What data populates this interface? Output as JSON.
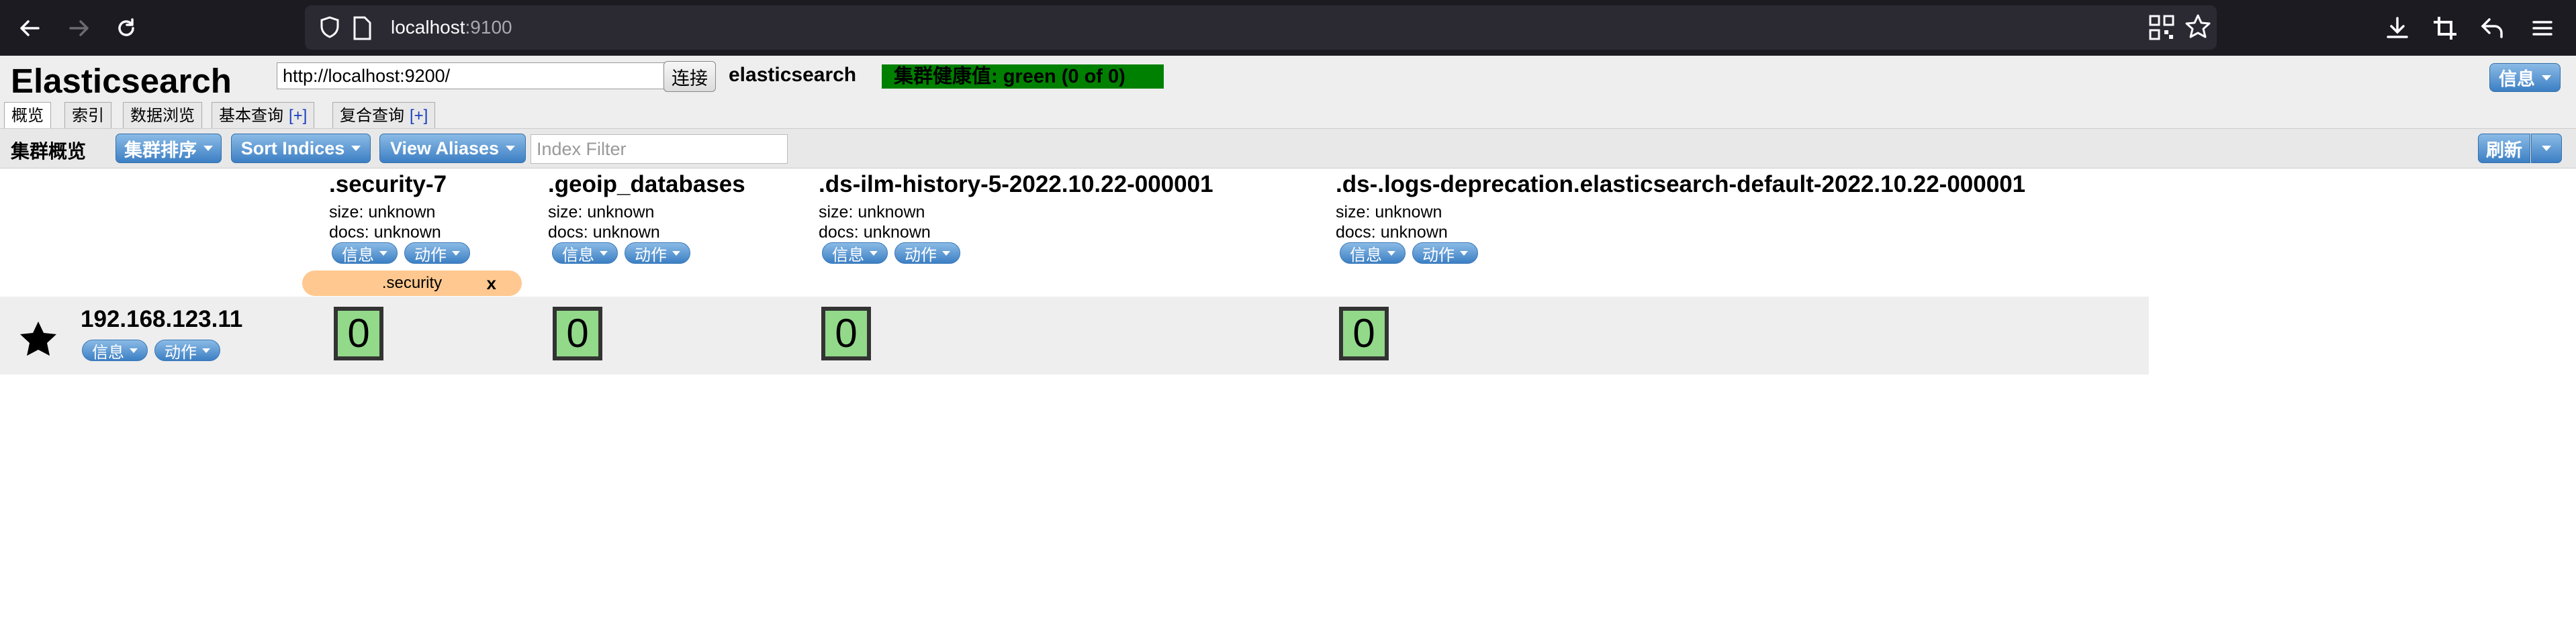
{
  "browser": {
    "url_host": "localhost",
    "url_port": ":9100"
  },
  "header": {
    "logo": "Elasticsearch",
    "cluster_url": "http://localhost:9200/",
    "connect_label": "连接",
    "cluster_name": "elasticsearch",
    "health": "集群健康值: green (0 of 0)",
    "info_label": "信息"
  },
  "tabs": [
    {
      "label": "概览",
      "plus": ""
    },
    {
      "label": "索引",
      "plus": ""
    },
    {
      "label": "数据浏览",
      "plus": ""
    },
    {
      "label": "基本查询",
      "plus": "[+]"
    },
    {
      "label": "复合查询",
      "plus": "[+]"
    }
  ],
  "toolbar": {
    "title": "集群概览",
    "sort_cluster_label": "集群排序",
    "sort_indices_label": "Sort Indices",
    "view_aliases_label": "View Aliases",
    "index_filter_placeholder": "Index Filter",
    "refresh_label": "刷新"
  },
  "indices": [
    {
      "name": ".security-7",
      "size": "size: unknown",
      "docs": "docs: unknown",
      "info": "信息",
      "action": "动作"
    },
    {
      "name": ".geoip_databases",
      "size": "size: unknown",
      "docs": "docs: unknown",
      "info": "信息",
      "action": "动作"
    },
    {
      "name": ".ds-ilm-history-5-2022.10.22-000001",
      "size": "size: unknown",
      "docs": "docs: unknown",
      "info": "信息",
      "action": "动作"
    },
    {
      "name": ".ds-.logs-deprecation.elasticsearch-default-2022.10.22-000001",
      "size": "size: unknown",
      "docs": "docs: unknown",
      "info": "信息",
      "action": "动作"
    }
  ],
  "alias": {
    "name": ".security",
    "close": "x"
  },
  "node": {
    "name": "192.168.123.11",
    "info": "信息",
    "action": "动作",
    "shards": [
      "0",
      "0",
      "0",
      "0"
    ]
  },
  "colors": {
    "health_green": "#008000",
    "shard_green": "#92d98a",
    "alias_orange": "#ffc890",
    "button_blue": "#3c7fc4"
  }
}
